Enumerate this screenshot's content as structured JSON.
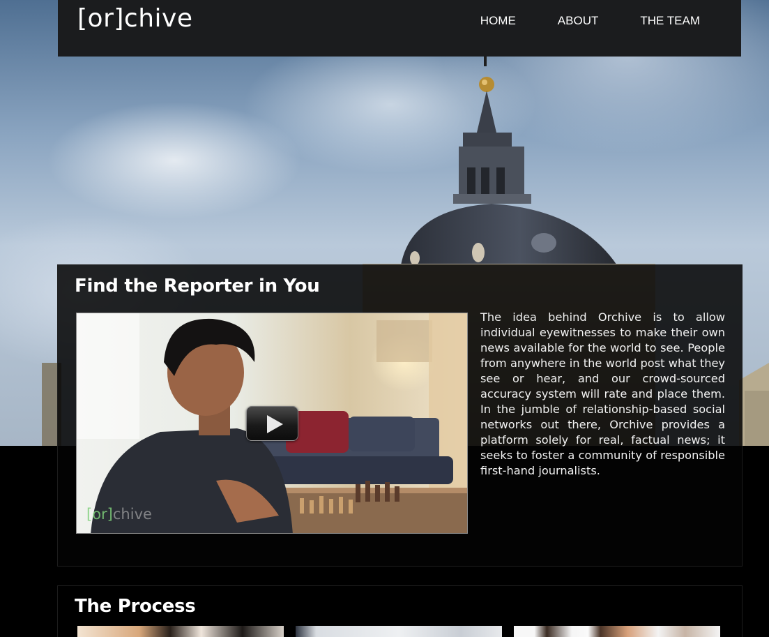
{
  "header": {
    "logo": "[or]chive",
    "nav": [
      {
        "label": "HOME"
      },
      {
        "label": "ABOUT"
      },
      {
        "label": "THE TEAM"
      }
    ]
  },
  "intro": {
    "title": "Find the Reporter in You",
    "video": {
      "watermark_bracket": "[or]",
      "watermark_rest": "chive",
      "play_icon": "play-icon"
    },
    "description": "The idea behind Orchive is to allow individual eyewitnesses to make their own news available for the world to see. People from anywhere in the world post what they see or hear, and our crowd-sourced accuracy system will rate and place them. In the jumble of relationship-based social networks out there, Orchive provides a platform solely for real, factual news; it seeks to foster a community of responsible first-hand journalists."
  },
  "process": {
    "title": "The Process"
  },
  "colors": {
    "header_bg": "#1b1c1e",
    "panel_bg": "#040404",
    "text": "#ffffff",
    "watermark_accent": "#7fd07a"
  }
}
